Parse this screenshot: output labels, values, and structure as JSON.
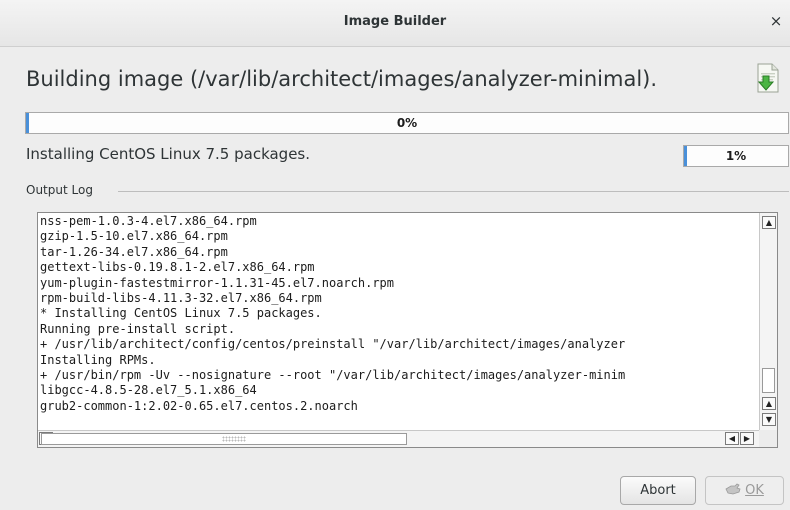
{
  "window": {
    "title": "Image Builder",
    "close_glyph": "×"
  },
  "heading": "Building image (/var/lib/architect/images/analyzer-minimal).",
  "heading_icon": "document-install-icon",
  "overall_progress": {
    "value": 0,
    "label": "0%"
  },
  "status_text": "Installing CentOS Linux 7.5 packages.",
  "package_progress": {
    "value": 1,
    "label": "1%"
  },
  "output_log": {
    "label": "Output Log",
    "lines": [
      "nss-pem-1.0.3-4.el7.x86_64.rpm",
      "gzip-1.5-10.el7.x86_64.rpm",
      "tar-1.26-34.el7.x86_64.rpm",
      "gettext-libs-0.19.8.1-2.el7.x86_64.rpm",
      "yum-plugin-fastestmirror-1.1.31-45.el7.noarch.rpm",
      "rpm-build-libs-4.11.3-32.el7.x86_64.rpm",
      "* Installing CentOS Linux 7.5 packages.",
      "Running pre-install script.",
      "+ /usr/lib/architect/config/centos/preinstall \"/var/lib/architect/images/analyzer",
      "Installing RPMs.",
      "+ /usr/bin/rpm -Uv --nosignature --root \"/var/lib/architect/images/analyzer-minim",
      "libgcc-4.8.5-28.el7_5.1.x86_64",
      "grub2-common-1:2.02-0.65.el7.centos.2.noarch"
    ]
  },
  "buttons": {
    "abort": "Abort",
    "ok": "OK"
  },
  "colors": {
    "progress_fill": "#4a90d9",
    "background": "#ededed"
  }
}
